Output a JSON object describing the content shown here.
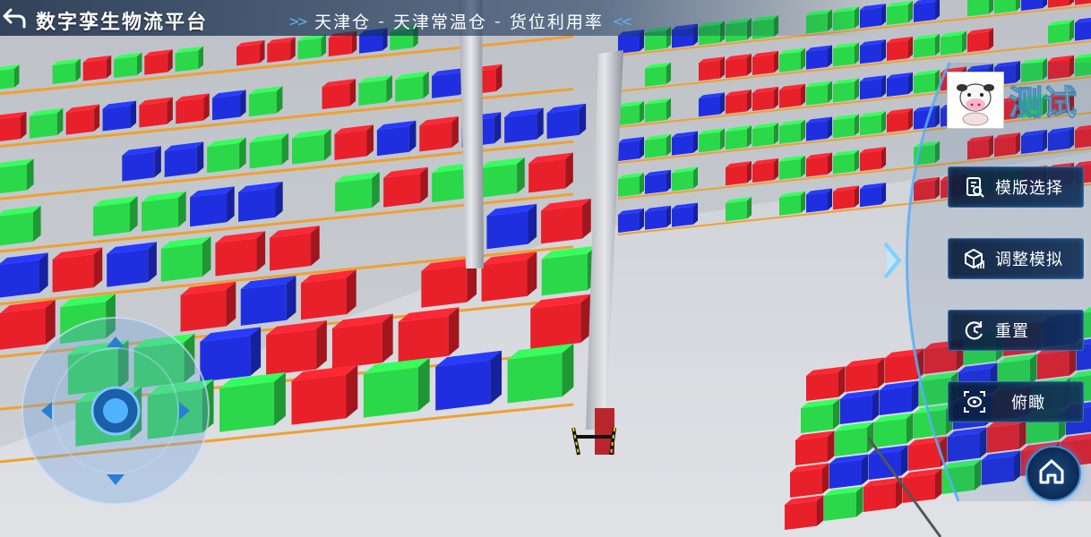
{
  "header": {
    "title": "数字孪生物流平台",
    "breadcrumb": [
      "天津仓",
      "天津常温仓",
      "货位利用率"
    ],
    "separator": "-"
  },
  "user": {
    "avatar_icon": "cow-avatar-icon",
    "overlay_text": "测试"
  },
  "menu": {
    "template_select": "模版选择",
    "adjust_simulation": "调整模拟",
    "reset": "重置",
    "overview": "俯瞰"
  },
  "controls": {
    "joystick": "joystick",
    "home": "home-icon"
  },
  "colors": {
    "accent": "#3f8fd6",
    "box_red": "#e8202a",
    "box_green": "#2bd84a",
    "box_blue": "#1f2fe0",
    "rack_orange": "#f0a030",
    "floor": "#cfd3d8"
  }
}
